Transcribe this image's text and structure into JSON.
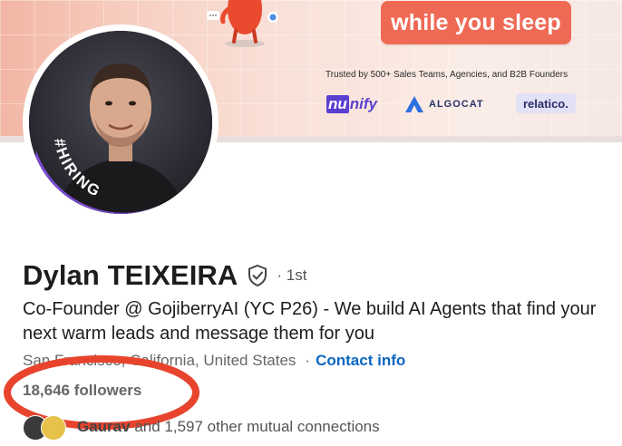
{
  "banner": {
    "cta_text": "while you sleep",
    "trusted_text": "Trusted by 500+ Sales Teams, Agencies, and B2B Founders",
    "logos": [
      "nunify",
      "ALGOCAT",
      "relatico."
    ],
    "accent_color": "#ef6a55"
  },
  "profile": {
    "hiring_badge": "#HIRING",
    "name": "Dylan TEIXEIRA",
    "connection_degree": "· 1st",
    "headline": "Co-Founder @ GojiberryAI (YC P26) - We build AI Agents that find your next warm leads and message them for you",
    "location": "San Francisco, California, United States",
    "contact_link": "Contact info",
    "followers": "18,646 followers",
    "mutual_connections": "and 1,597 other mutual connections",
    "mutual_name_fragment": "Gaurav"
  },
  "colors": {
    "link": "#0a66c2",
    "hiring_purple": "#7b4bd1",
    "annotation_red": "#e8442d"
  },
  "icons": [
    "verified-shield-icon",
    "mascot-illustration",
    "chat-bubble-icon"
  ]
}
